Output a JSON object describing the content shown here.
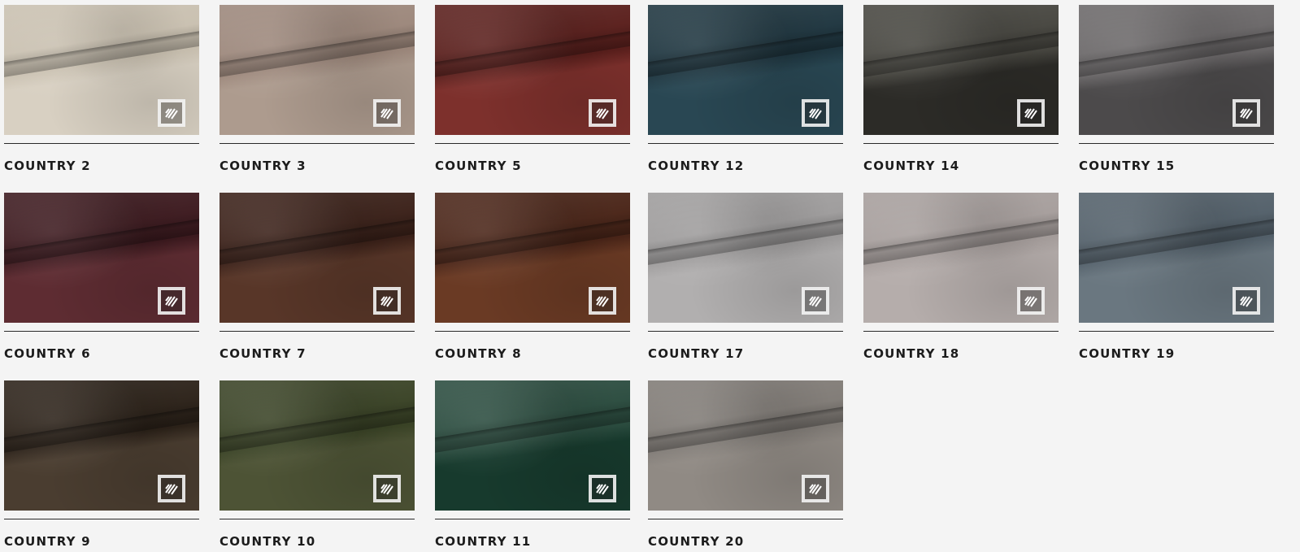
{
  "swatches": [
    {
      "label": "COUNTRY 2",
      "color_top": "#c9c0b0",
      "color_bottom": "#d8d0c2",
      "icon": "fabric-pattern-icon"
    },
    {
      "label": "COUNTRY 3",
      "color_top": "#9c877b",
      "color_bottom": "#ad9b8e",
      "icon": "fabric-pattern-icon"
    },
    {
      "label": "COUNTRY 5",
      "color_top": "#5a1f1c",
      "color_bottom": "#7d302c",
      "icon": "fabric-pattern-icon"
    },
    {
      "label": "COUNTRY 12",
      "color_top": "#1f3640",
      "color_bottom": "#294753",
      "icon": "fabric-pattern-icon"
    },
    {
      "label": "COUNTRY 14",
      "color_top": "#474640",
      "color_bottom": "#2c2b27",
      "icon": "fabric-pattern-icon"
    },
    {
      "label": "COUNTRY 15",
      "color_top": "#6b6869",
      "color_bottom": "#4c4a4b",
      "icon": "fabric-pattern-icon"
    },
    {
      "label": "COUNTRY 6",
      "color_top": "#3d1a1f",
      "color_bottom": "#5e2c32",
      "icon": "fabric-pattern-icon"
    },
    {
      "label": "COUNTRY 7",
      "color_top": "#3b2119",
      "color_bottom": "#583628",
      "icon": "fabric-pattern-icon"
    },
    {
      "label": "COUNTRY 8",
      "color_top": "#4a2518",
      "color_bottom": "#6a3a24",
      "icon": "fabric-pattern-icon"
    },
    {
      "label": "COUNTRY 17",
      "color_top": "#9e9c9c",
      "color_bottom": "#b1afaf",
      "icon": "fabric-pattern-icon"
    },
    {
      "label": "COUNTRY 18",
      "color_top": "#a69e9c",
      "color_bottom": "#b5adab",
      "icon": "fabric-pattern-icon"
    },
    {
      "label": "COUNTRY 19",
      "color_top": "#53606a",
      "color_bottom": "#6a7780",
      "icon": "fabric-pattern-icon"
    },
    {
      "label": "COUNTRY 9",
      "color_top": "#2c2219",
      "color_bottom": "#4a3d30",
      "icon": "fabric-pattern-icon"
    },
    {
      "label": "COUNTRY 10",
      "color_top": "#3a4326",
      "color_bottom": "#4d5335",
      "icon": "fabric-pattern-icon"
    },
    {
      "label": "COUNTRY 11",
      "color_top": "#2b4c3f",
      "color_bottom": "#173a2d",
      "icon": "fabric-pattern-icon"
    },
    {
      "label": "COUNTRY 20",
      "color_top": "#807b76",
      "color_bottom": "#908a84",
      "icon": "fabric-pattern-icon"
    }
  ]
}
